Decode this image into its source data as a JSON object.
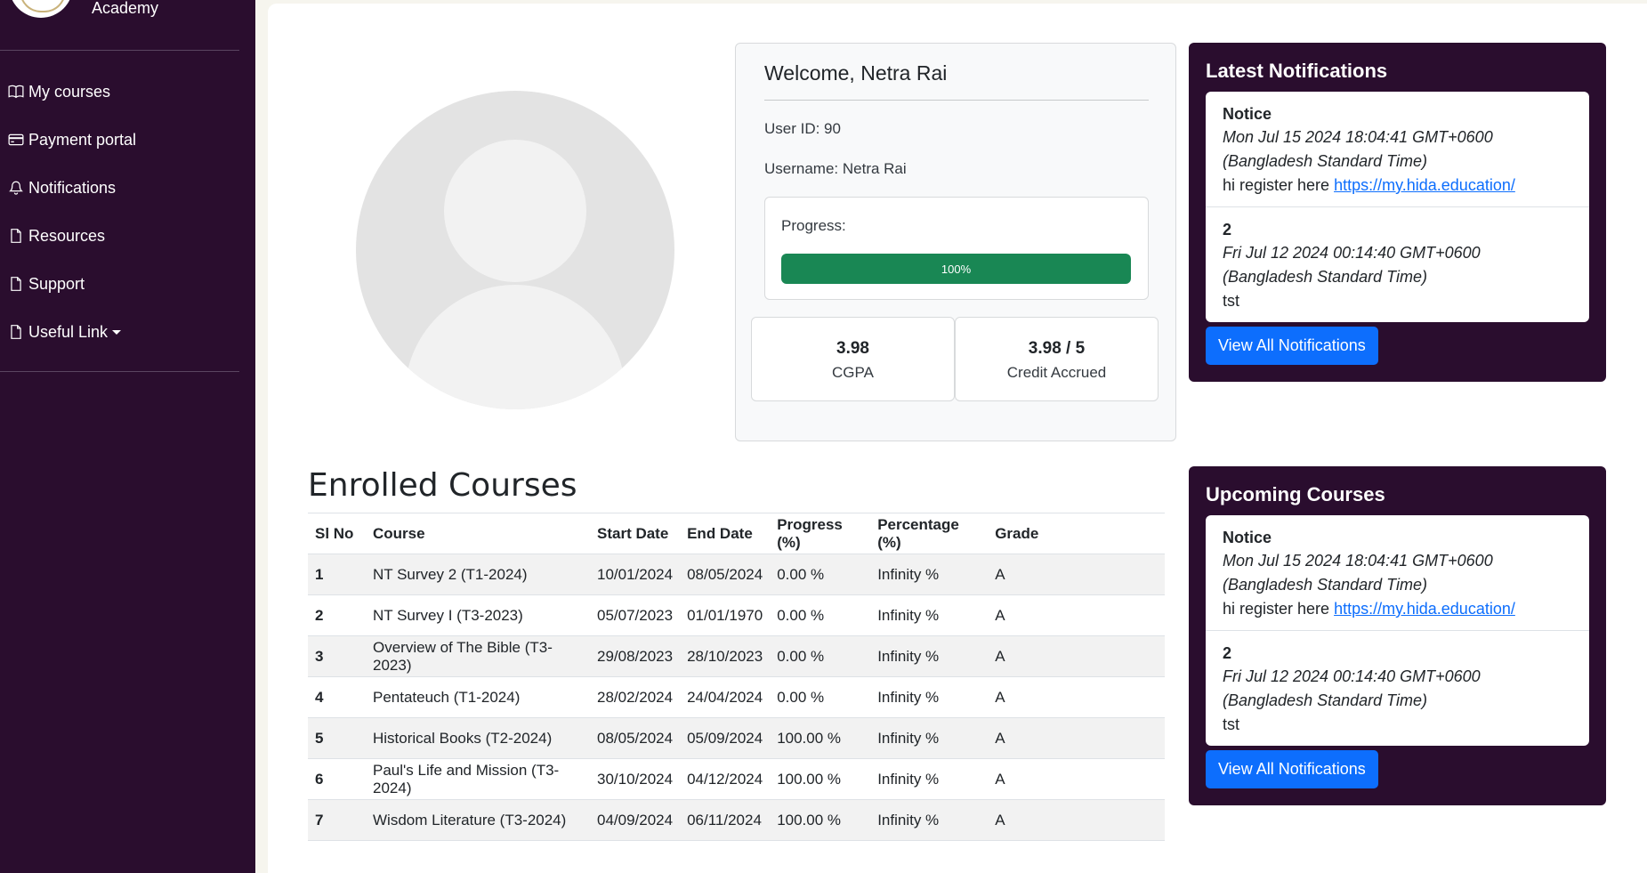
{
  "sidebar": {
    "brand_text": "Academy",
    "nav": [
      {
        "label": "My courses",
        "icon": "book-icon"
      },
      {
        "label": "Payment portal",
        "icon": "credit-card-icon"
      },
      {
        "label": "Notifications",
        "icon": "bell-icon"
      },
      {
        "label": "Resources",
        "icon": "file-icon"
      },
      {
        "label": "Support",
        "icon": "file-icon"
      },
      {
        "label": "Useful Link",
        "icon": "file-icon"
      }
    ]
  },
  "profile": {
    "welcome": "Welcome, Netra Rai",
    "user_id": "User ID: 90",
    "username": "Username: Netra Rai",
    "progress_label": "Progress:",
    "progress_text": "100%",
    "progress_value": 100,
    "progress_color": "#198754",
    "cgpa_value": "3.98",
    "cgpa_label": "CGPA",
    "credit_value": "3.98 / 5",
    "credit_label": "Credit Accrued"
  },
  "latest_notifications": {
    "title": "Latest Notifications",
    "items": [
      {
        "title": "Notice",
        "date": "Mon Jul 15 2024 18:04:41 GMT+0600 (Bangladesh Standard Time)",
        "body": "hi register here ",
        "link": "https://my.hida.education/"
      },
      {
        "title": "2",
        "date": "Fri Jul 12 2024 00:14:40 GMT+0600 (Bangladesh Standard Time)",
        "body": "tst",
        "link": ""
      }
    ],
    "button": "View All Notifications"
  },
  "upcoming_courses": {
    "title": "Upcoming Courses",
    "items": [
      {
        "title": "Notice",
        "date": "Mon Jul 15 2024 18:04:41 GMT+0600 (Bangladesh Standard Time)",
        "body": "hi register here ",
        "link": "https://my.hida.education/"
      },
      {
        "title": "2",
        "date": "Fri Jul 12 2024 00:14:40 GMT+0600 (Bangladesh Standard Time)",
        "body": "tst",
        "link": ""
      }
    ],
    "button": "View All Notifications"
  },
  "enrolled": {
    "title": "Enrolled Courses",
    "headers": [
      "Sl No",
      "Course",
      "Start Date",
      "End Date",
      "Progress (%)",
      "Percentage (%)",
      "Grade"
    ],
    "rows": [
      [
        "1",
        "NT Survey 2 (T1-2024)",
        "10/01/2024",
        "08/05/2024",
        "0.00 %",
        "Infinity %",
        "A"
      ],
      [
        "2",
        "NT Survey I (T3-2023)",
        "05/07/2023",
        "01/01/1970",
        "0.00 %",
        "Infinity %",
        "A"
      ],
      [
        "3",
        "Overview of The Bible (T3-2023)",
        "29/08/2023",
        "28/10/2023",
        "0.00 %",
        "Infinity %",
        "A"
      ],
      [
        "4",
        "Pentateuch (T1-2024)",
        "28/02/2024",
        "24/04/2024",
        "0.00 %",
        "Infinity %",
        "A"
      ],
      [
        "5",
        "Historical Books (T2-2024)",
        "08/05/2024",
        "05/09/2024",
        "100.00 %",
        "Infinity %",
        "A"
      ],
      [
        "6",
        "Paul's Life and Mission (T3-2024)",
        "30/10/2024",
        "04/12/2024",
        "100.00 %",
        "Infinity %",
        "A"
      ],
      [
        "7",
        "Wisdom Literature (T3-2024)",
        "04/09/2024",
        "06/11/2024",
        "100.00 %",
        "Infinity %",
        "A"
      ]
    ]
  }
}
